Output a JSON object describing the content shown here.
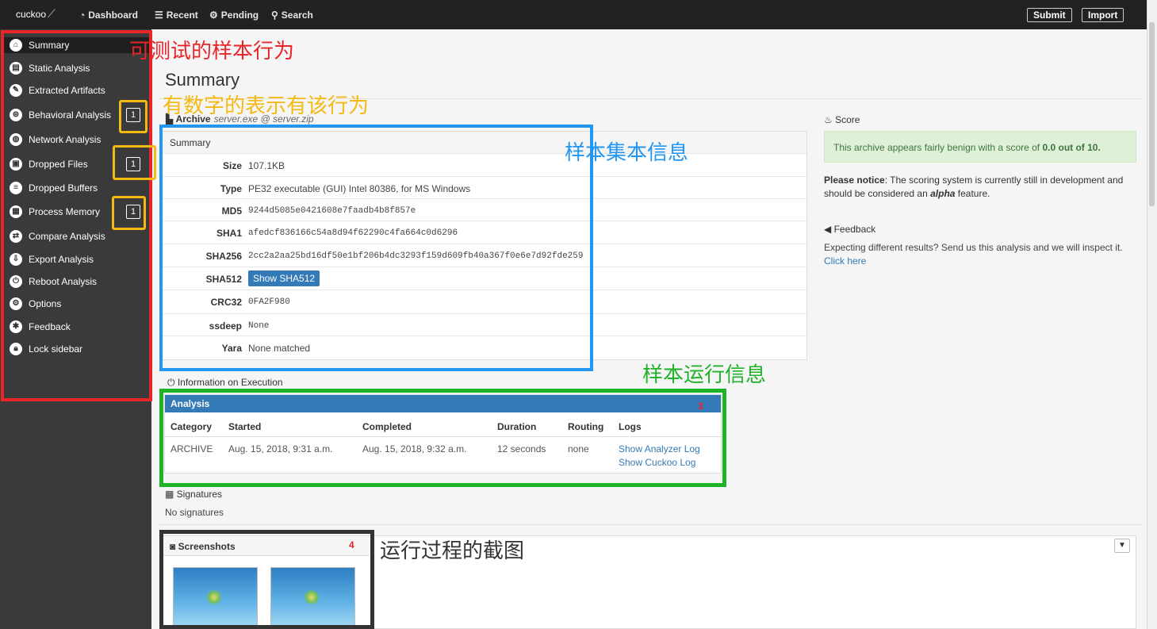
{
  "navbar": {
    "brand": "cuckoo",
    "items": [
      {
        "icon": "dashboard-icon",
        "label": "Dashboard"
      },
      {
        "icon": "list-icon",
        "label": "Recent"
      },
      {
        "icon": "gears-icon",
        "label": "Pending"
      },
      {
        "icon": "search-icon",
        "label": "Search"
      }
    ],
    "submit": "Submit",
    "import": "Import"
  },
  "sidebar": {
    "items": [
      {
        "label": "Summary",
        "badge": ""
      },
      {
        "label": "Static Analysis",
        "badge": ""
      },
      {
        "label": "Extracted Artifacts",
        "badge": ""
      },
      {
        "label": "Behavioral Analysis",
        "badge": "1"
      },
      {
        "label": "Network Analysis",
        "badge": ""
      },
      {
        "label": "Dropped Files",
        "badge": "1"
      },
      {
        "label": "Dropped Buffers",
        "badge": ""
      },
      {
        "label": "Process Memory",
        "badge": "1"
      },
      {
        "label": "Compare Analysis",
        "badge": ""
      },
      {
        "label": "Export Analysis",
        "badge": ""
      },
      {
        "label": "Reboot Analysis",
        "badge": ""
      },
      {
        "label": "Options",
        "badge": ""
      },
      {
        "label": "Feedback",
        "badge": ""
      },
      {
        "label": "Lock sidebar",
        "badge": ""
      }
    ]
  },
  "annotations": {
    "sidebar_note": "可测试的样本行为",
    "badge_note": "有数字的表示有该行为",
    "summary_note": "样本集本信息",
    "exec_note": "样本运行信息",
    "shots_note": "运行过程的截图",
    "num3": "3",
    "num4": "4",
    "colors": {
      "red": "#e8262a",
      "orange": "#f5b914",
      "blue": "#2196f3",
      "green": "#1fb329",
      "dark": "#333333"
    }
  },
  "main": {
    "title": "Summary",
    "archive_label": "Archive",
    "archive_file": "server.exe @ server.zip",
    "summary_heading": "Summary",
    "rows": [
      {
        "key": "Size",
        "value": "107.1KB",
        "mono": false
      },
      {
        "key": "Type",
        "value": "PE32 executable (GUI) Intel 80386, for MS Windows",
        "mono": false
      },
      {
        "key": "MD5",
        "value": "9244d5085e0421608e7faadb4b8f857e",
        "mono": true
      },
      {
        "key": "SHA1",
        "value": "afedcf836166c54a8d94f62290c4fa664c0d6296",
        "mono": true
      },
      {
        "key": "SHA256",
        "value": "2cc2a2aa25bd16df50e1bf206b4dc3293f159d609fb40a367f0e6e7d92fde259",
        "mono": true
      },
      {
        "key": "SHA512",
        "value": "",
        "mono": false
      },
      {
        "key": "CRC32",
        "value": "0FA2F980",
        "mono": true
      },
      {
        "key": "ssdeep",
        "value": "None",
        "mono": true
      },
      {
        "key": "Yara",
        "value": "None matched",
        "mono": false
      }
    ],
    "sha512_button": "Show SHA512",
    "exec_label": "Information on Execution",
    "analysis_heading": "Analysis",
    "analysis_cols": [
      "Category",
      "Started",
      "Completed",
      "Duration",
      "Routing",
      "Logs"
    ],
    "analysis_row": {
      "category": "ARCHIVE",
      "started": "Aug. 15, 2018, 9:31 a.m.",
      "completed": "Aug. 15, 2018, 9:32 a.m.",
      "duration": "12 seconds",
      "routing": "none",
      "log1": "Show Analyzer Log",
      "log2": "Show Cuckoo Log"
    },
    "signatures_label": "Signatures",
    "signatures_none": "No signatures",
    "screenshots_label": "Screenshots"
  },
  "right": {
    "score_label": "Score",
    "score_text": "This archive appears fairly benign with a score of ",
    "score_value": "0.0 out of 10.",
    "notice_bold": "Please notice",
    "notice_text": ": The scoring system is currently still in development and should be considered an ",
    "notice_em": "alpha",
    "notice_tail": " feature.",
    "feedback_label": "Feedback",
    "feedback_text": "Expecting different results? Send us this analysis and we will inspect it.",
    "feedback_link": "Click here"
  }
}
